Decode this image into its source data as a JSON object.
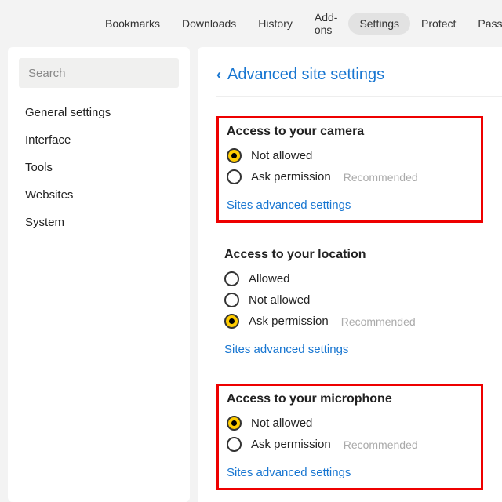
{
  "topbar": {
    "tabs": [
      "Bookmarks",
      "Downloads",
      "History",
      "Add-ons",
      "Settings",
      "Protect",
      "Passwords"
    ],
    "active": "Settings"
  },
  "sidebar": {
    "search_placeholder": "Search",
    "items": [
      "General settings",
      "Interface",
      "Tools",
      "Websites",
      "System"
    ]
  },
  "main": {
    "breadcrumb": "Advanced site settings",
    "sections": [
      {
        "title": "Access to your camera",
        "boxed": true,
        "options": [
          {
            "label": "Not allowed",
            "selected": true,
            "recommended": false
          },
          {
            "label": "Ask permission",
            "selected": false,
            "recommended": true
          }
        ],
        "link": "Sites advanced settings"
      },
      {
        "title": "Access to your location",
        "boxed": false,
        "options": [
          {
            "label": "Allowed",
            "selected": false,
            "recommended": false
          },
          {
            "label": "Not allowed",
            "selected": false,
            "recommended": false
          },
          {
            "label": "Ask permission",
            "selected": true,
            "recommended": true
          }
        ],
        "link": "Sites advanced settings"
      },
      {
        "title": "Access to your microphone",
        "boxed": true,
        "options": [
          {
            "label": "Not allowed",
            "selected": true,
            "recommended": false
          },
          {
            "label": "Ask permission",
            "selected": false,
            "recommended": true
          }
        ],
        "link": "Sites advanced settings"
      }
    ],
    "recommended_label": "Recommended"
  }
}
